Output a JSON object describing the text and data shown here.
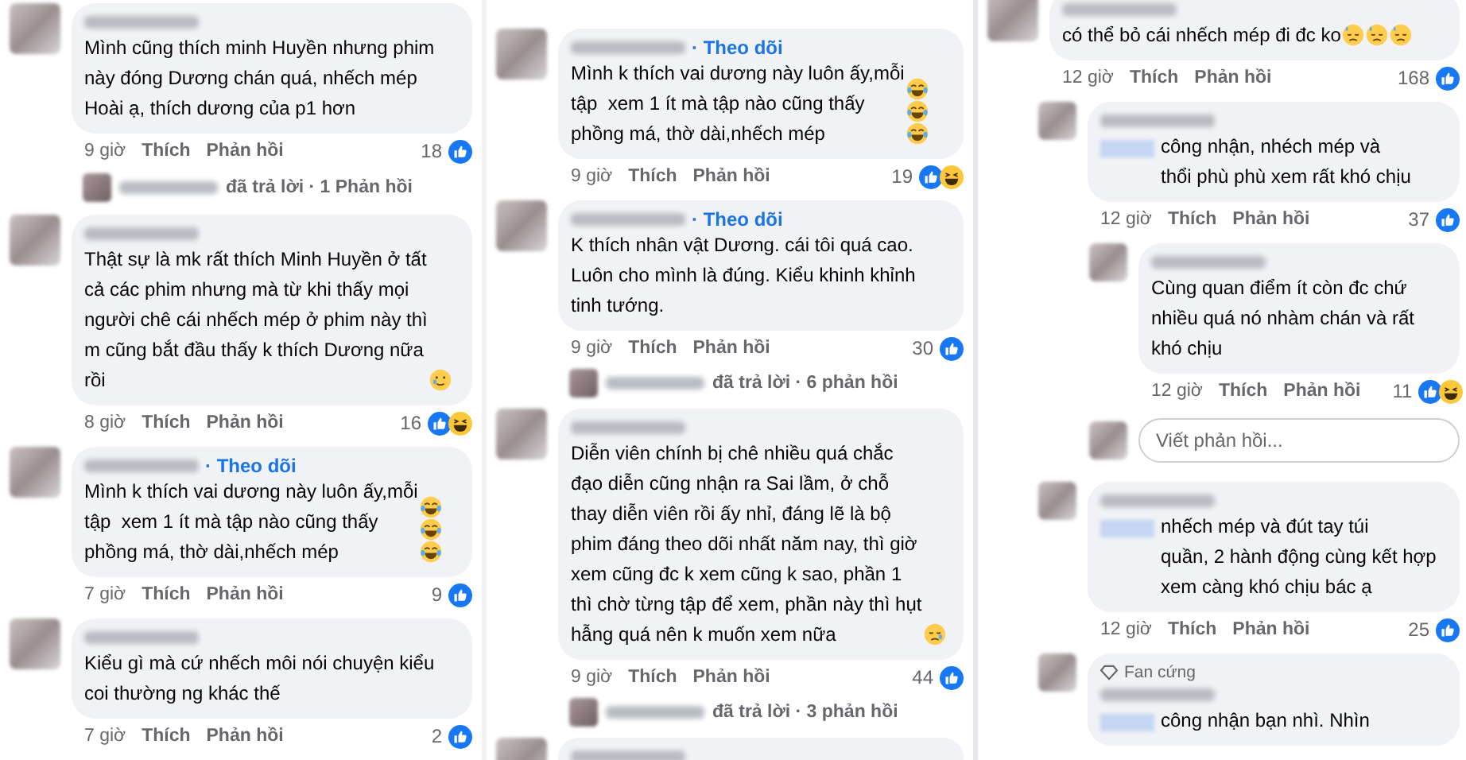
{
  "panels": [
    {
      "items": [
        {
          "kind": "comment",
          "text": "Mình cũng thích minh Huyền nhưng phim\nnày đóng Dương chán quá, nhếch mép\nHoài ạ, thích dương của p1 hơn",
          "time": "9 giờ",
          "like": "Thích",
          "reply": "Phản hồi",
          "count": "18",
          "reactions": [
            {
              "kind": "like"
            }
          ]
        },
        {
          "kind": "replied",
          "text": "đã trả lời · 1 Phản hồi"
        },
        {
          "kind": "comment",
          "text": "Thật sự là mk rất thích Minh Huyền ở tất\ncả các phim nhưng mà từ khi thấy mọi\nngười chê cái nhếch mép ở phim này thì\nm cũng bắt đầu thấy k thích Dương nữa\nrồi",
          "emojis": [
            {
              "kind": "tear"
            }
          ],
          "time": "8 giờ",
          "like": "Thích",
          "reply": "Phản hồi",
          "count": "16",
          "reactions": [
            {
              "kind": "like"
            },
            {
              "kind": "haha"
            }
          ]
        },
        {
          "kind": "comment",
          "follow": "· Theo dõi",
          "text": "Mình k thích vai dương này luôn ấy,mỗi\ntập  xem 1 ít mà tập nào cũng thấy\nphồng má, thờ dài,nhếch mép",
          "emojis": [
            {
              "kind": "laugh"
            },
            {
              "kind": "laugh"
            },
            {
              "kind": "laugh"
            }
          ],
          "time": "7 giờ",
          "like": "Thích",
          "reply": "Phản hồi",
          "count": "9",
          "reactions": [
            {
              "kind": "like"
            }
          ]
        },
        {
          "kind": "comment",
          "text": "Kiểu gì mà cứ nhếch môi nói chuyện kiểu\ncoi thường ng khác thế",
          "time": "7 giờ",
          "like": "Thích",
          "reply": "Phản hồi",
          "count": "2",
          "reactions": [
            {
              "kind": "like"
            }
          ]
        }
      ]
    },
    {
      "items": [
        {
          "kind": "comment",
          "follow": "· Theo dõi",
          "text": "Mình k thích vai dương này luôn ấy,mỗi\ntập  xem 1 ít mà tập nào cũng thấy\nphồng má, thờ dài,nhếch mép",
          "emojis": [
            {
              "kind": "laugh"
            },
            {
              "kind": "laugh"
            },
            {
              "kind": "laugh"
            }
          ],
          "time": "9 giờ",
          "like": "Thích",
          "reply": "Phản hồi",
          "count": "19",
          "reactions": [
            {
              "kind": "like"
            },
            {
              "kind": "haha"
            }
          ]
        },
        {
          "kind": "comment",
          "follow": "· Theo dõi",
          "text": "K thích nhân vật Dương. cái tôi quá cao.\nLuôn cho mình là đúng. Kiểu khinh khỉnh\ntinh tướng.",
          "time": "9 giờ",
          "like": "Thích",
          "reply": "Phản hồi",
          "count": "30",
          "reactions": [
            {
              "kind": "like"
            }
          ]
        },
        {
          "kind": "replied",
          "text": "đã trả lời · 6 phản hồi"
        },
        {
          "kind": "comment",
          "text": "Diễn viên chính bị chê nhiều quá chắc\nđạo diễn cũng nhận ra Sai lầm, ở chỗ\nthay diễn viên rồi ấy nhỉ, đáng lẽ là bộ\nphim đáng theo dõi nhất năm nay, thì giờ\nxem cũng đc k xem cũng k sao, phần 1\nthì chờ từng tập để xem, phần này thì hụt\nhẫng quá nên k muốn xem nữa",
          "emojis": [
            {
              "kind": "sad"
            }
          ],
          "time": "9 giờ",
          "like": "Thích",
          "reply": "Phản hồi",
          "count": "44",
          "reactions": [
            {
              "kind": "like"
            }
          ]
        },
        {
          "kind": "replied",
          "text": "đã trả lời · 3 phản hồi"
        },
        {
          "kind": "comment"
        }
      ]
    },
    {
      "items": [
        {
          "kind": "comment",
          "text": "có thể bỏ cái nhếch mép đi đc ko",
          "emojis": [
            {
              "kind": "sweat"
            },
            {
              "kind": "sweat"
            },
            {
              "kind": "sweat"
            }
          ],
          "time": "12 giờ",
          "like": "Thích",
          "reply": "Phản hồi",
          "count": "168",
          "reactions": [
            {
              "kind": "like"
            }
          ],
          "replies": [
            {
              "kind": "comment",
              "mention": true,
              "text": "công nhận, nhéch mép và\nthổi phù phù xem rất khó chịu",
              "time": "12 giờ",
              "like": "Thích",
              "reply": "Phản hồi",
              "count": "37",
              "reactions": [
                {
                  "kind": "like"
                }
              ],
              "replies": [
                {
                  "kind": "comment",
                  "text": "Cùng quan điểm ít còn đc chứ\nnhiều quá nó nhàm chán và rất\nkhó chịu",
                  "time": "12 giờ",
                  "like": "Thích",
                  "reply": "Phản hồi",
                  "count": "11",
                  "reactions": [
                    {
                      "kind": "like"
                    },
                    {
                      "kind": "haha"
                    }
                  ]
                },
                {
                  "kind": "reply_box",
                  "placeholder": "Viết phản hồi..."
                }
              ]
            },
            {
              "kind": "comment",
              "mention": true,
              "text": "nhếch mép và đút tay túi\nquần, 2 hành động cùng kết hợp\nxem càng khó chịu bác ạ",
              "time": "12 giờ",
              "like": "Thích",
              "reply": "Phản hồi",
              "count": "25",
              "reactions": [
                {
                  "kind": "like"
                }
              ]
            },
            {
              "kind": "comment",
              "badge": "Fan cứng",
              "mention": true,
              "text": "công nhận bạn nhì. Nhìn"
            }
          ]
        }
      ]
    }
  ]
}
